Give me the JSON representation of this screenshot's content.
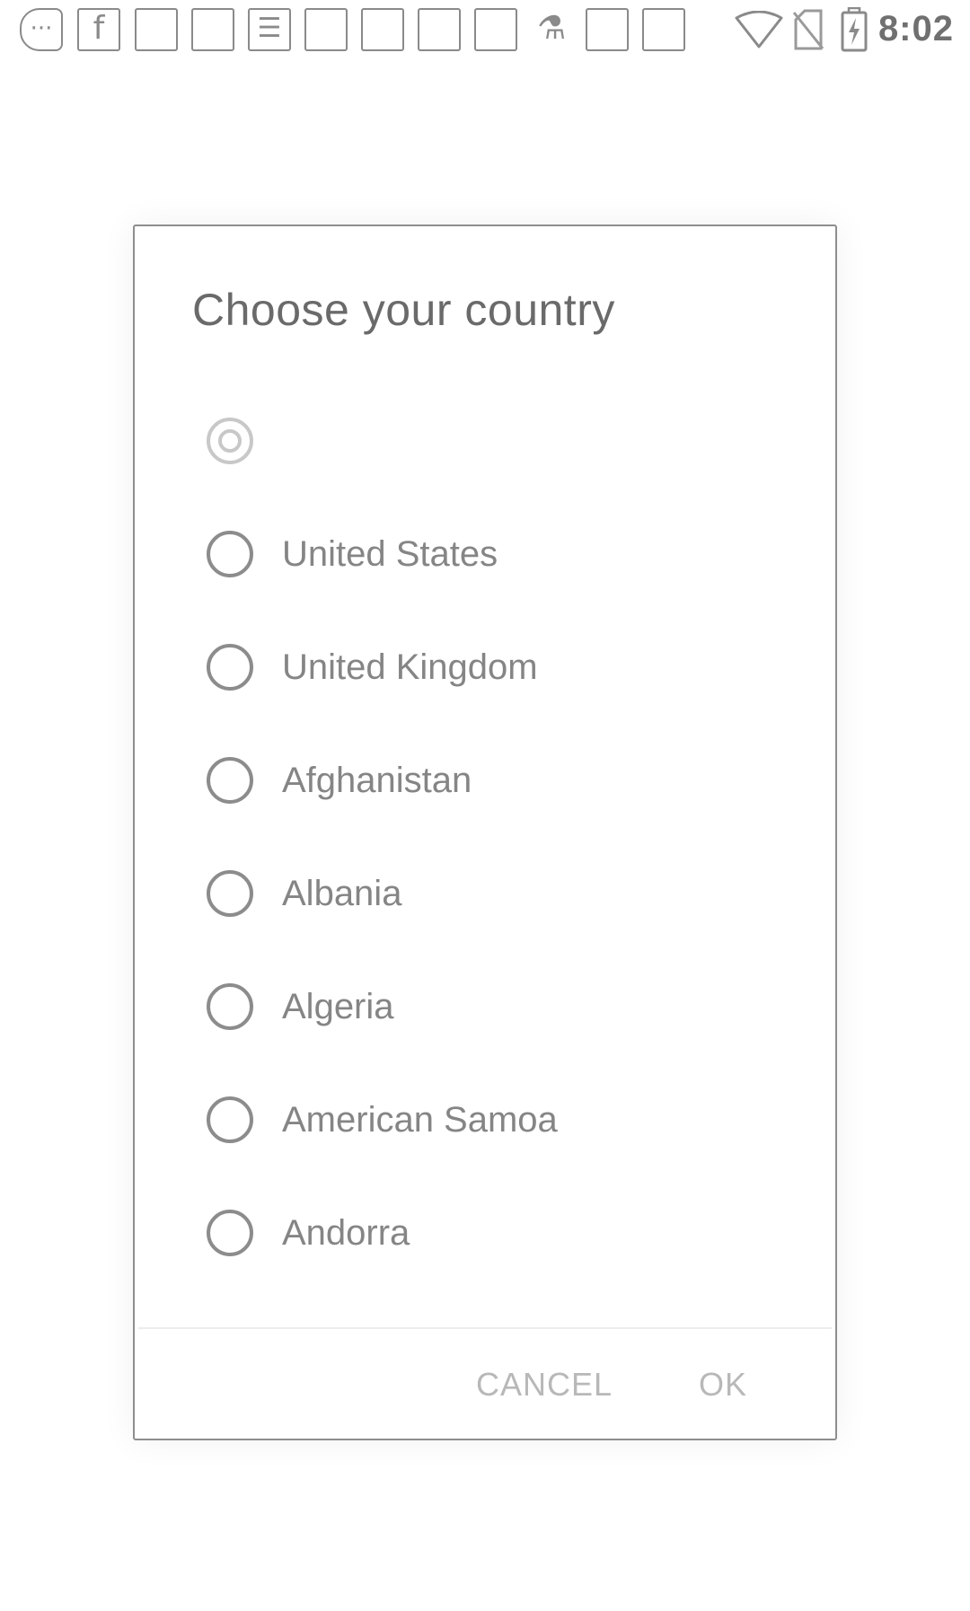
{
  "status_bar": {
    "time": "8:02",
    "notification_icons": [
      "back-chat-icon",
      "facebook-icon",
      "blank-icon",
      "blank-icon",
      "news-icon",
      "blank-icon",
      "blank-icon",
      "blank-icon",
      "blank-icon",
      "microscope-icon",
      "blank-icon",
      "blank-icon"
    ],
    "system_icons": [
      "wifi-icon",
      "no-sim-icon",
      "battery-charging-icon"
    ]
  },
  "dialog": {
    "title": "Choose your country",
    "options": [
      {
        "label": "",
        "selected": true
      },
      {
        "label": "United States",
        "selected": false
      },
      {
        "label": "United Kingdom",
        "selected": false
      },
      {
        "label": "Afghanistan",
        "selected": false
      },
      {
        "label": "Albania",
        "selected": false
      },
      {
        "label": "Algeria",
        "selected": false
      },
      {
        "label": "American Samoa",
        "selected": false
      },
      {
        "label": "Andorra",
        "selected": false
      }
    ],
    "cancel_label": "CANCEL",
    "ok_label": "OK"
  }
}
